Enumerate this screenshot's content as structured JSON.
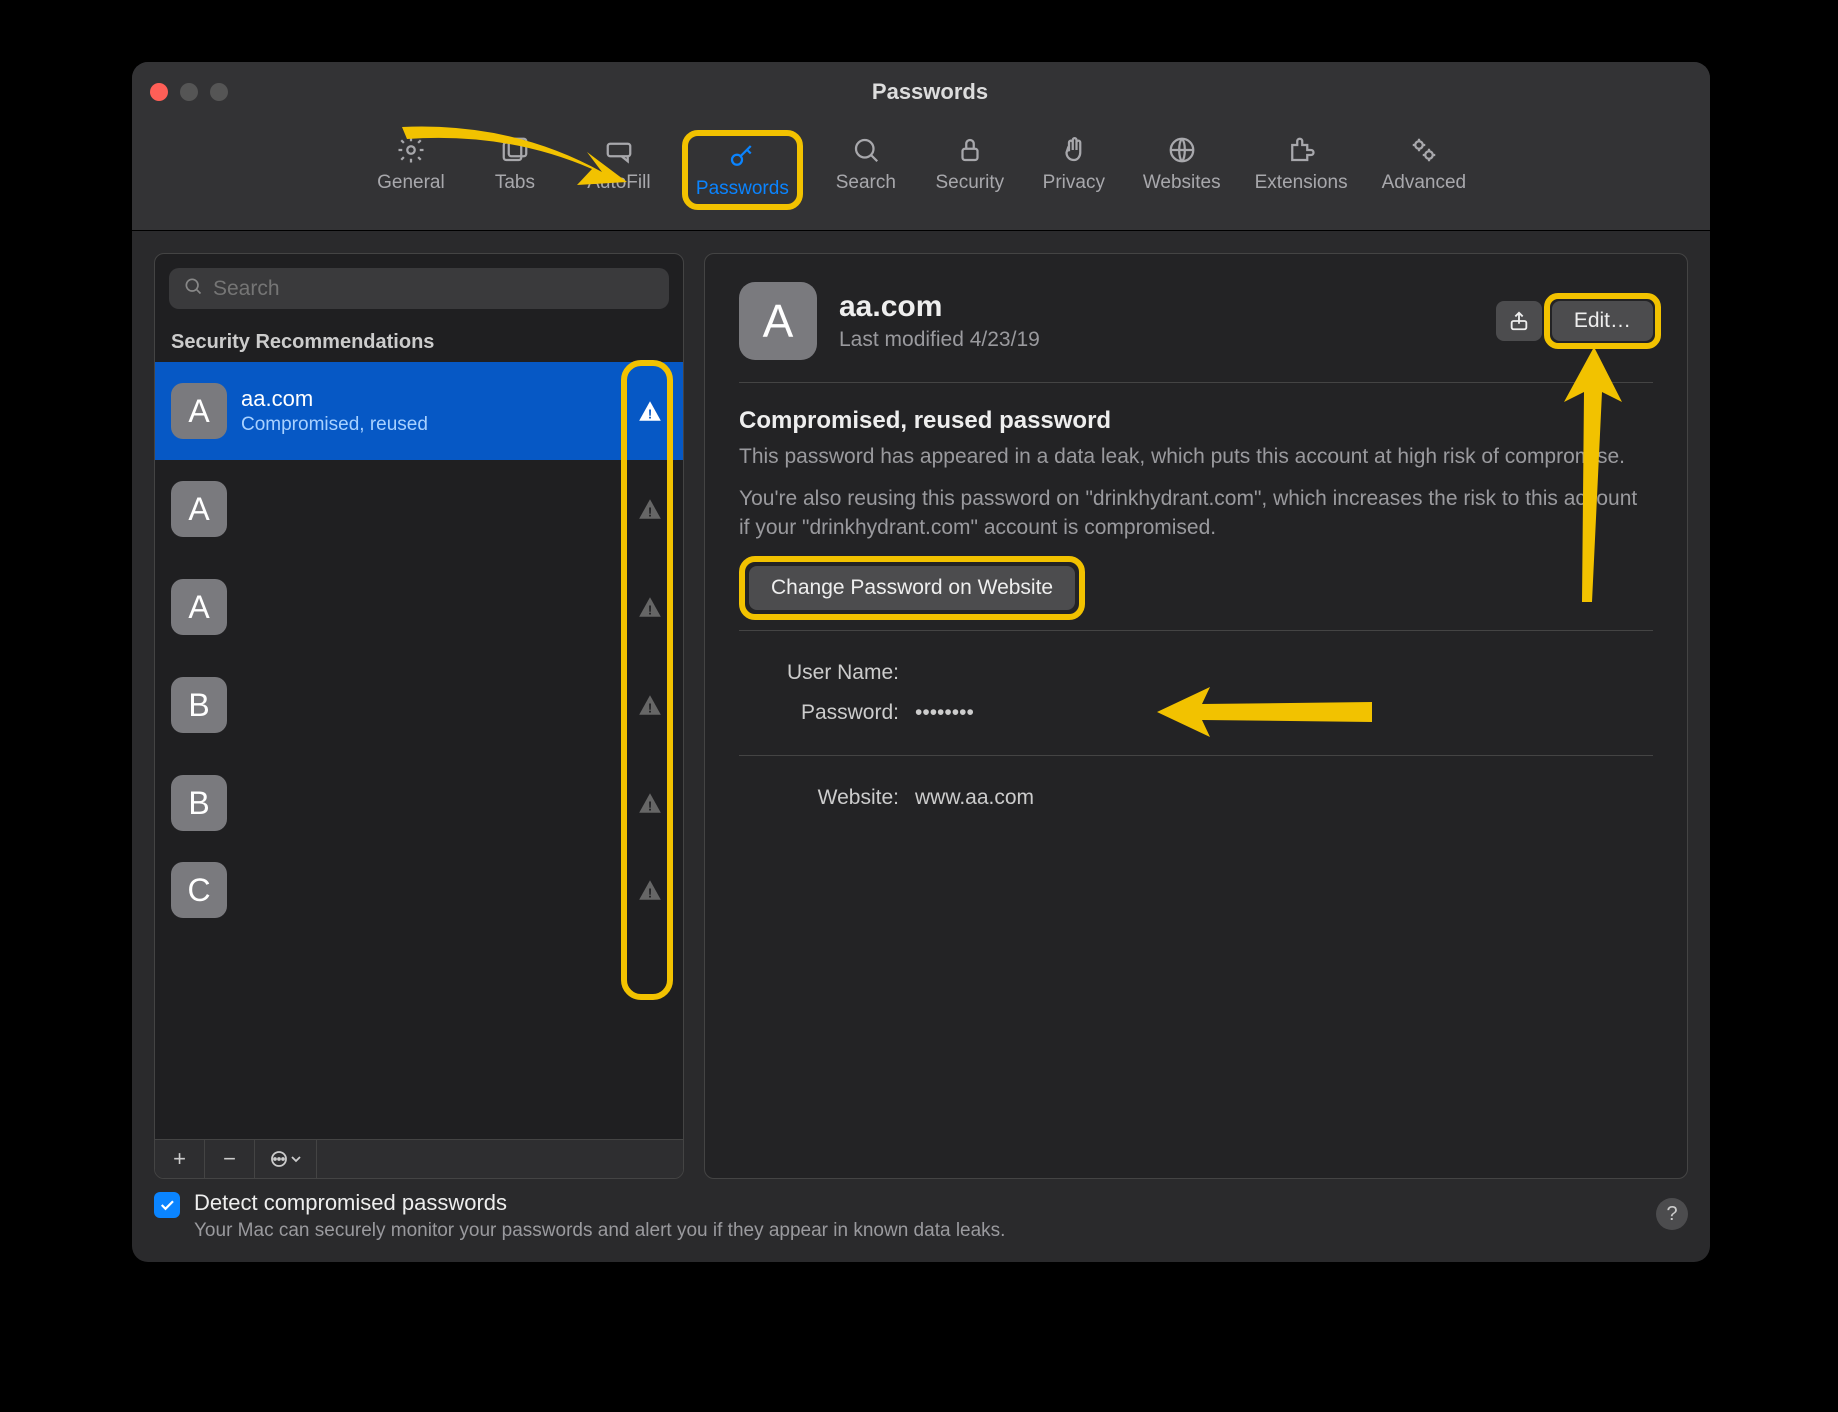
{
  "window": {
    "title": "Passwords"
  },
  "toolbar": {
    "items": [
      {
        "label": "General"
      },
      {
        "label": "Tabs"
      },
      {
        "label": "AutoFill"
      },
      {
        "label": "Passwords"
      },
      {
        "label": "Search"
      },
      {
        "label": "Security"
      },
      {
        "label": "Privacy"
      },
      {
        "label": "Websites"
      },
      {
        "label": "Extensions"
      },
      {
        "label": "Advanced"
      }
    ]
  },
  "sidebar": {
    "search_placeholder": "Search",
    "section_label": "Security Recommendations",
    "items": [
      {
        "letter": "A",
        "domain": "aa.com",
        "sub": "Compromised, reused",
        "selected": true
      },
      {
        "letter": "A",
        "domain": "",
        "sub": "",
        "selected": false
      },
      {
        "letter": "A",
        "domain": "",
        "sub": "",
        "selected": false
      },
      {
        "letter": "B",
        "domain": "",
        "sub": "",
        "selected": false
      },
      {
        "letter": "B",
        "domain": "",
        "sub": "",
        "selected": false
      },
      {
        "letter": "C",
        "domain": "",
        "sub": "",
        "selected": false
      }
    ],
    "footer": {
      "add": "+",
      "remove": "−",
      "more": "⊙⌄"
    }
  },
  "detail": {
    "letter": "A",
    "title": "aa.com",
    "modified": "Last modified 4/23/19",
    "share_icon": "share",
    "edit_label": "Edit…",
    "warning_title": "Compromised, reused password",
    "warning_p1": "This password has appeared in a data leak, which puts this account at high risk of compromise.",
    "warning_p2": "You're also reusing this password on \"drinkhydrant.com\", which increases the risk to this account if your \"drinkhydrant.com\" account is compromised.",
    "change_label": "Change Password on Website",
    "fields": {
      "username_label": "User Name:",
      "username_value": "",
      "password_label": "Password:",
      "password_value": "••••••••",
      "website_label": "Website:",
      "website_value": "www.aa.com"
    }
  },
  "bottom": {
    "checkbox_label": "Detect compromised passwords",
    "checkbox_desc": "Your Mac can securely monitor your passwords and alert you if they appear in known data leaks.",
    "help": "?"
  }
}
